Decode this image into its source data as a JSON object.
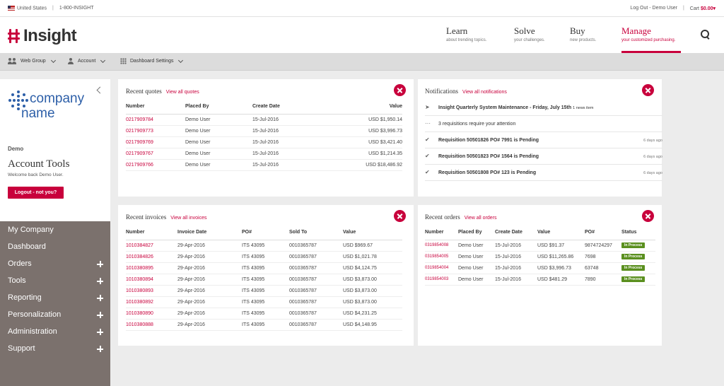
{
  "topbar": {
    "country": "United States",
    "phone": "1-800-INSIGHT",
    "logout": "Log Out - Demo User",
    "cart_label": "Cart",
    "cart_amount": "$0.00▾"
  },
  "header": {
    "logo_text": "Insight",
    "nav": [
      {
        "title": "Learn",
        "sub": "about trending topics."
      },
      {
        "title": "Solve",
        "sub": "your challenges."
      },
      {
        "title": "Buy",
        "sub": "new products."
      },
      {
        "title": "Manage",
        "sub": "your customized purchasing."
      }
    ]
  },
  "subnav": {
    "web_group": "Web Group",
    "account": "Account",
    "dashboard_settings": "Dashboard Settings"
  },
  "sidebar": {
    "company_line1": "company",
    "company_line2": "name",
    "user_short": "Demo",
    "title": "Account Tools",
    "welcome": "Welcome back Demo User.",
    "logout_button": "Logout - not you?",
    "menu": [
      "My Company",
      "Dashboard",
      "Orders",
      "Tools",
      "Reporting",
      "Personalization",
      "Administration",
      "Support"
    ]
  },
  "quotes": {
    "title": "Recent quotes",
    "link": "View all quotes",
    "headers": [
      "Number",
      "Placed By",
      "Create Date",
      "Value"
    ],
    "rows": [
      [
        "0217909784",
        "Demo User",
        "15-Jul-2016",
        "USD $1,950.14"
      ],
      [
        "0217909773",
        "Demo User",
        "15-Jul-2016",
        "USD $3,996.73"
      ],
      [
        "0217909769",
        "Demo User",
        "15-Jul-2016",
        "USD $3,421.40"
      ],
      [
        "0217909767",
        "Demo User",
        "15-Jul-2016",
        "USD $1,214.35"
      ],
      [
        "0217909766",
        "Demo User",
        "15-Jul-2016",
        "USD $18,486.92"
      ]
    ]
  },
  "notifications": {
    "title": "Notifications",
    "link": "View all notifications",
    "items": [
      {
        "icon": "send",
        "text": "Insight Quarterly System Maintenance - Friday, July 15th",
        "extra": "1 news item",
        "age": ""
      },
      {
        "icon": "dots",
        "text": "3 requisitions require your attention",
        "extra": "",
        "age": ""
      },
      {
        "icon": "check",
        "text": "Requisition 50501826 PO# 7991 is Pending",
        "extra": "",
        "age": "6 days ago"
      },
      {
        "icon": "check",
        "text": "Requisition 50501823 PO# 1564 is Pending",
        "extra": "",
        "age": "6 days ago"
      },
      {
        "icon": "check",
        "text": "Requisition 50501808 PO# 123 is Pending",
        "extra": "",
        "age": "6 days ago"
      }
    ]
  },
  "invoices": {
    "title": "Recent invoices",
    "link": "View all invoices",
    "headers": [
      "Number",
      "Invoice Date",
      "PO#",
      "Sold To",
      "Value"
    ],
    "rows": [
      [
        "1010384827",
        "29-Apr-2016",
        "ITS 43095",
        "0010365787",
        "USD $969.67"
      ],
      [
        "1010384826",
        "29-Apr-2016",
        "ITS 43095",
        "0010365787",
        "USD $1,021.78"
      ],
      [
        "1010380895",
        "29-Apr-2016",
        "ITS 43095",
        "0010365787",
        "USD $4,124.75"
      ],
      [
        "1010380894",
        "29-Apr-2016",
        "ITS 43095",
        "0010365787",
        "USD $3,873.00"
      ],
      [
        "1010380893",
        "29-Apr-2016",
        "ITS 43095",
        "0010365787",
        "USD $3,873.00"
      ],
      [
        "1010380892",
        "29-Apr-2016",
        "ITS 43095",
        "0010365787",
        "USD $3,873.00"
      ],
      [
        "1010380890",
        "29-Apr-2016",
        "ITS 43095",
        "0010365787",
        "USD $4,231.25"
      ],
      [
        "1010380888",
        "29-Apr-2016",
        "ITS 43095",
        "0010365787",
        "USD $4,148.95"
      ]
    ]
  },
  "orders": {
    "title": "Recent orders",
    "link": "View all orders",
    "headers": [
      "Number",
      "Placed By",
      "Create Date",
      "Value",
      "PO#",
      "Status"
    ],
    "rows": [
      [
        "0319854008",
        "Demo User",
        "15-Jul-2016",
        "USD $91.37",
        "9874724297",
        "In Process"
      ],
      [
        "0319854005",
        "Demo User",
        "15-Jul-2016",
        "USD $11,265.86",
        "7698",
        "In Process"
      ],
      [
        "0319854004",
        "Demo User",
        "15-Jul-2016",
        "USD $3,996.73",
        "63748",
        "In Process"
      ],
      [
        "0319854003",
        "Demo User",
        "15-Jul-2016",
        "USD $481.29",
        "7890",
        "In Process"
      ]
    ]
  },
  "colors": {
    "accent": "#c8003c",
    "sidebar_menu": "#7b716d",
    "status_green": "#5a8f1e",
    "company_blue": "#2d5fa8"
  }
}
